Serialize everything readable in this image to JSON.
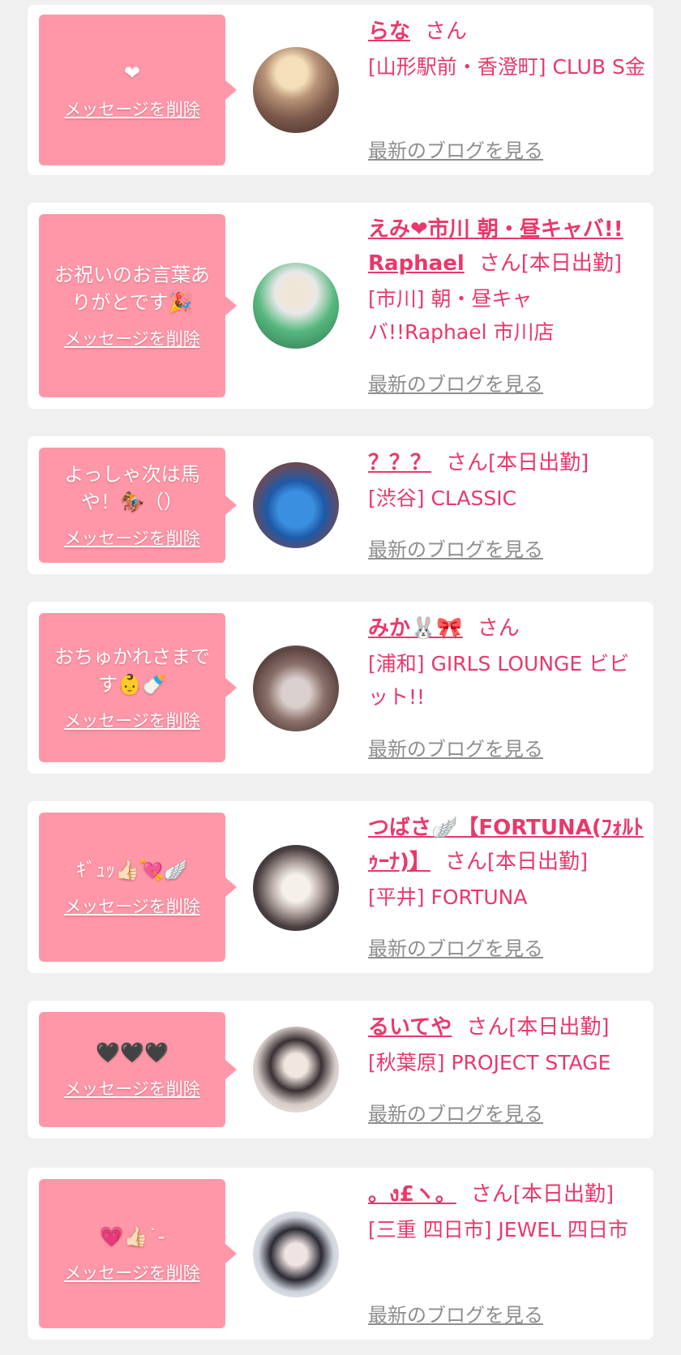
{
  "labels": {
    "delete": "メッセージを削除",
    "blog": "最新のブログを見る"
  },
  "items": [
    {
      "message": "❤",
      "name": "らな",
      "suffix": "さん",
      "shop": "[山形駅前・香澄町] CLUB S金"
    },
    {
      "message": "お祝いのお言葉ありがとです🎉",
      "name": "えみ❤市川 朝・昼キャバ!! Raphael",
      "suffix": "さん[本日出勤]",
      "shop": "[市川] 朝・昼キャバ!!Raphael 市川店"
    },
    {
      "message": "よっしゃ次は馬や！🏇（）",
      "name": "？？？",
      "suffix": "さん[本日出勤]",
      "shop": "[渋谷] CLASSIC"
    },
    {
      "message": "おちゅかれさまです👶🍼",
      "name": "みか🐰🎀",
      "suffix": "さん",
      "shop": "[浦和] GIRLS LOUNGE ビビット!!"
    },
    {
      "message": "ｷﾞｭｯ👍🏻💘🪽",
      "name": "つばさ🪽【FORTUNA(ﾌｫﾙﾄｩｰﾅ)】",
      "suffix": "さん[本日出勤]",
      "shop": "[平井] FORTUNA"
    },
    {
      "message": "🖤🖤🖤",
      "name": "るいてや",
      "suffix": "さん[本日出勤]",
      "shop": "[秋葉原] PROJECT STAGE"
    },
    {
      "message": "💗👍🏻˙-",
      "name": "。ง£ヽ。",
      "suffix": "さん[本日出勤]",
      "shop": "[三重 四日市] JEWEL 四日市"
    }
  ]
}
